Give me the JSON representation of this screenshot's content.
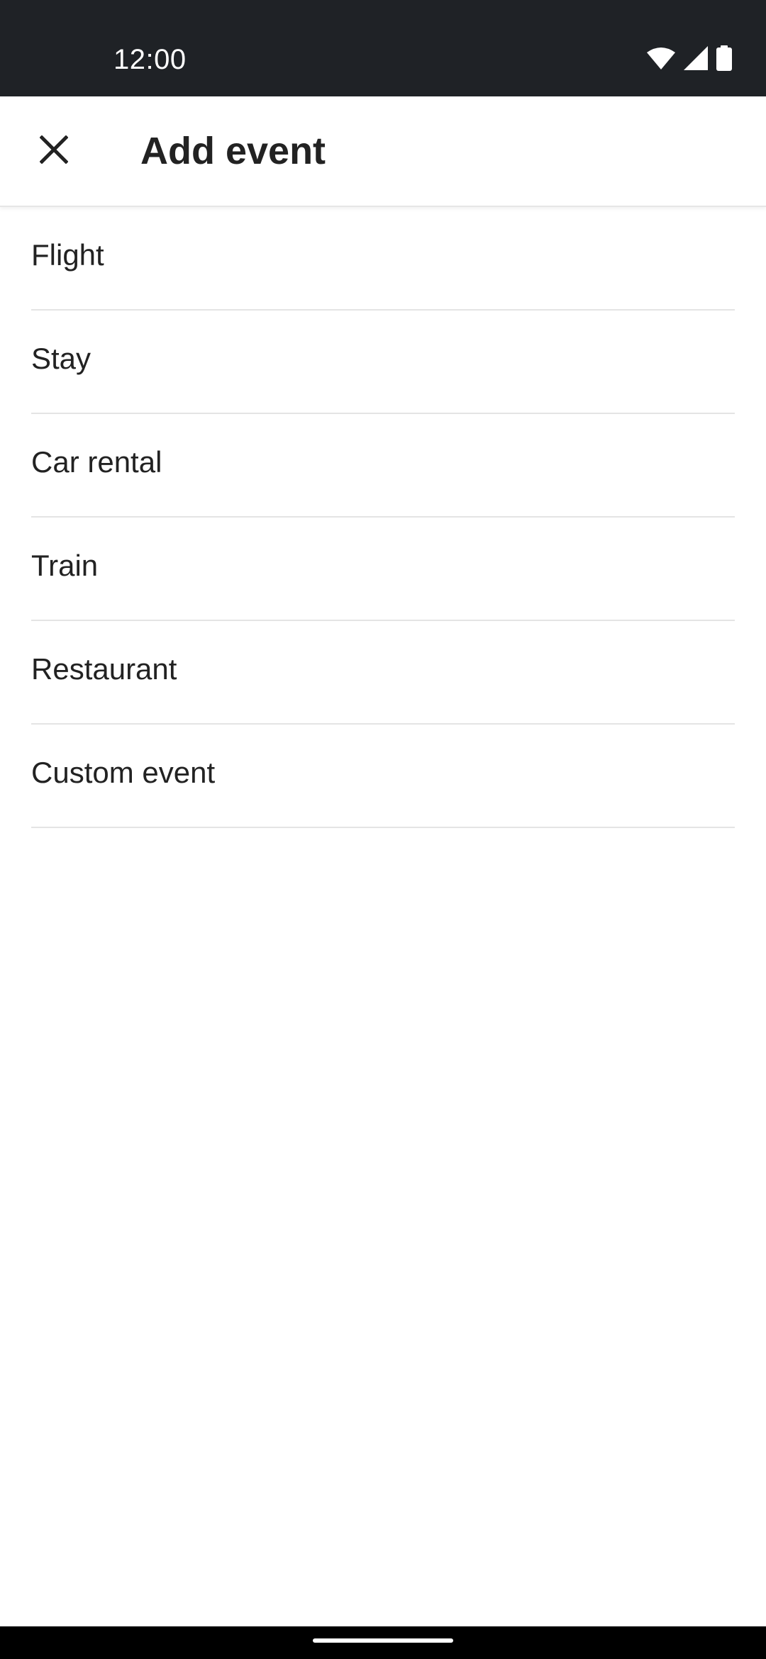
{
  "status_bar": {
    "time": "12:00",
    "icons": [
      "wifi-icon",
      "cellular-signal-icon",
      "battery-icon"
    ],
    "background": "#1f2226"
  },
  "toolbar": {
    "close_icon": "close-icon",
    "title": "Add event"
  },
  "events": [
    {
      "label": "Flight"
    },
    {
      "label": "Stay"
    },
    {
      "label": "Car rental"
    },
    {
      "label": "Train"
    },
    {
      "label": "Restaurant"
    },
    {
      "label": "Custom event"
    }
  ],
  "colors": {
    "text": "#222222",
    "divider": "#e4e4e4",
    "background": "#ffffff"
  }
}
